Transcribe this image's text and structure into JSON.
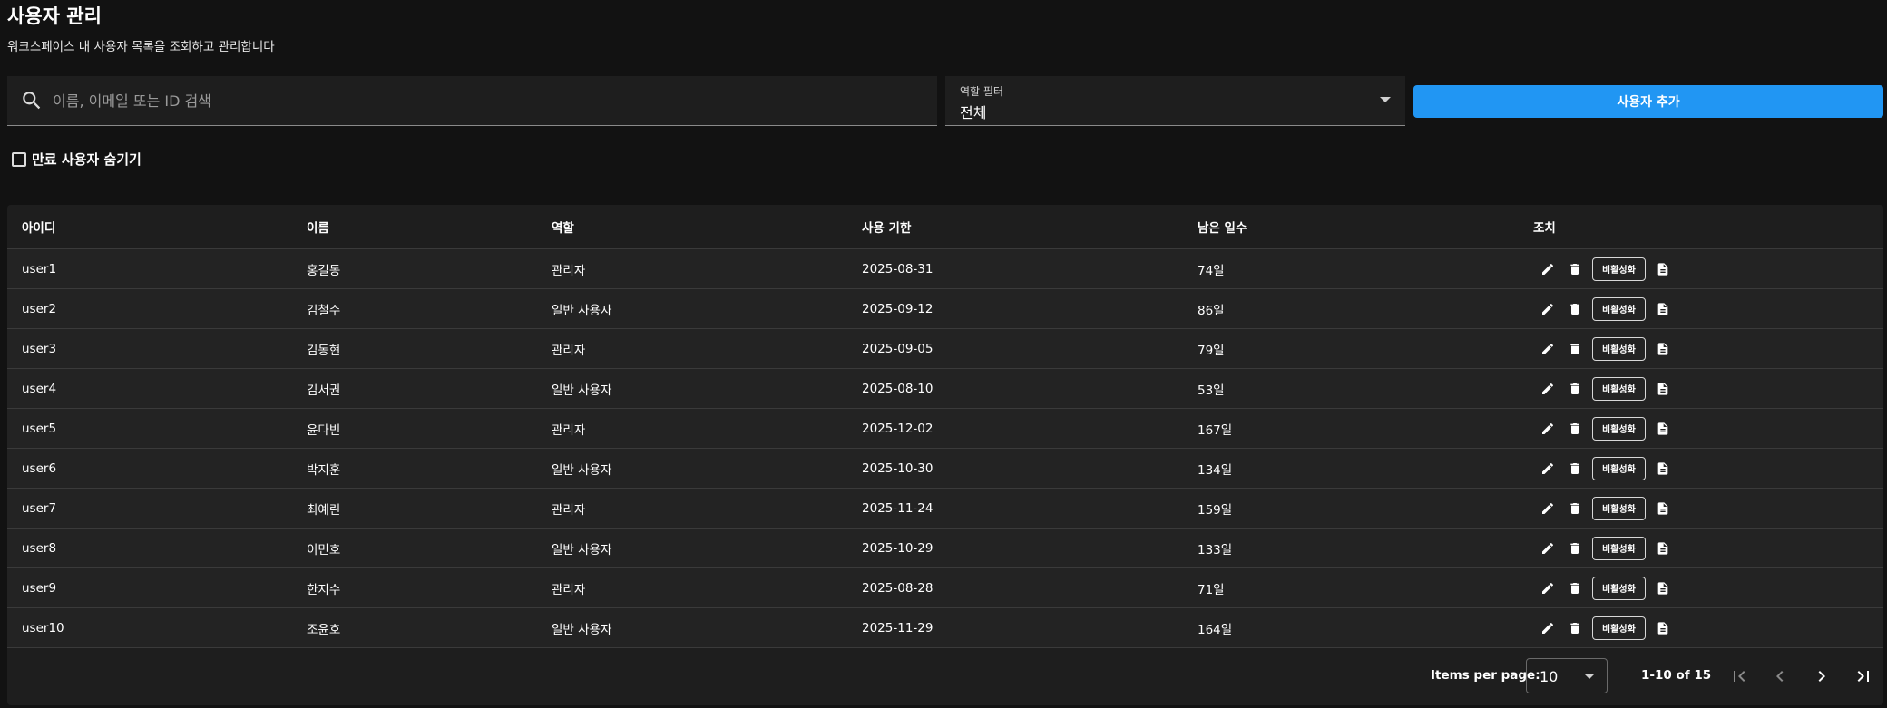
{
  "header": {
    "title": "사용자 관리",
    "subtitle": "워크스페이스 내 사용자 목록을 조회하고 관리합니다"
  },
  "search": {
    "placeholder": "이름, 이메일 또는 ID 검색",
    "value": "",
    "icon": "search-icon"
  },
  "role_filter": {
    "label": "역할 필터",
    "value": "전체"
  },
  "add_user_button": "사용자 추가",
  "hide_expired": {
    "label": "만료 사용자 숨기기",
    "checked": false
  },
  "table": {
    "columns": [
      "아이디",
      "이름",
      "역할",
      "사용 기한",
      "남은 일수",
      "조치"
    ],
    "deactivate_label": "비활성화",
    "action_icons": [
      "edit-icon",
      "delete-icon",
      "document-icon"
    ],
    "rows": [
      {
        "id": "user1",
        "name": "홍길동",
        "role": "관리자",
        "expiry": "2025-08-31",
        "days": "74일"
      },
      {
        "id": "user2",
        "name": "김철수",
        "role": "일반 사용자",
        "expiry": "2025-09-12",
        "days": "86일"
      },
      {
        "id": "user3",
        "name": "김동현",
        "role": "관리자",
        "expiry": "2025-09-05",
        "days": "79일"
      },
      {
        "id": "user4",
        "name": "김서권",
        "role": "일반 사용자",
        "expiry": "2025-08-10",
        "days": "53일"
      },
      {
        "id": "user5",
        "name": "윤다빈",
        "role": "관리자",
        "expiry": "2025-12-02",
        "days": "167일"
      },
      {
        "id": "user6",
        "name": "박지훈",
        "role": "일반 사용자",
        "expiry": "2025-10-30",
        "days": "134일"
      },
      {
        "id": "user7",
        "name": "최예린",
        "role": "관리자",
        "expiry": "2025-11-24",
        "days": "159일"
      },
      {
        "id": "user8",
        "name": "이민호",
        "role": "일반 사용자",
        "expiry": "2025-10-29",
        "days": "133일"
      },
      {
        "id": "user9",
        "name": "한지수",
        "role": "관리자",
        "expiry": "2025-08-28",
        "days": "71일"
      },
      {
        "id": "user10",
        "name": "조윤호",
        "role": "일반 사용자",
        "expiry": "2025-11-29",
        "days": "164일"
      }
    ]
  },
  "paginator": {
    "items_per_page_label": "Items per page:",
    "page_size": "10",
    "range": "1-10 of 15"
  },
  "colors": {
    "accent": "#2196f3",
    "background": "#121212",
    "surface": "#1e1e1e"
  }
}
